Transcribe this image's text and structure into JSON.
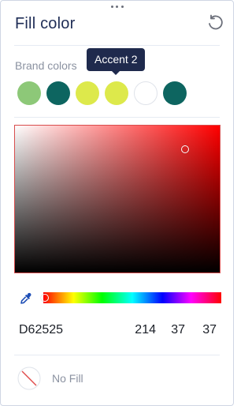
{
  "panel": {
    "title": "Fill color",
    "reset_icon": "reset-icon",
    "drag_handle_icon": "drag-handle-icon"
  },
  "brand": {
    "label": "Brand colors",
    "swatches": [
      {
        "name": "green",
        "color": "#8dc878"
      },
      {
        "name": "teal",
        "color": "#0d6560"
      },
      {
        "name": "yellow-green",
        "color": "#dde94b"
      },
      {
        "name": "accent-2",
        "color": "#dde94b"
      },
      {
        "name": "white",
        "color": "#ffffff"
      },
      {
        "name": "teal-2",
        "color": "#0d6560"
      }
    ],
    "tooltip": "Accent 2"
  },
  "picker": {
    "hue_color": "#ff0000",
    "eyedropper_icon": "eyedropper-icon",
    "hex": "D62525",
    "r": "214",
    "g": "37",
    "b": "37"
  },
  "no_fill": {
    "label": "No Fill",
    "icon": "no-fill-icon"
  }
}
